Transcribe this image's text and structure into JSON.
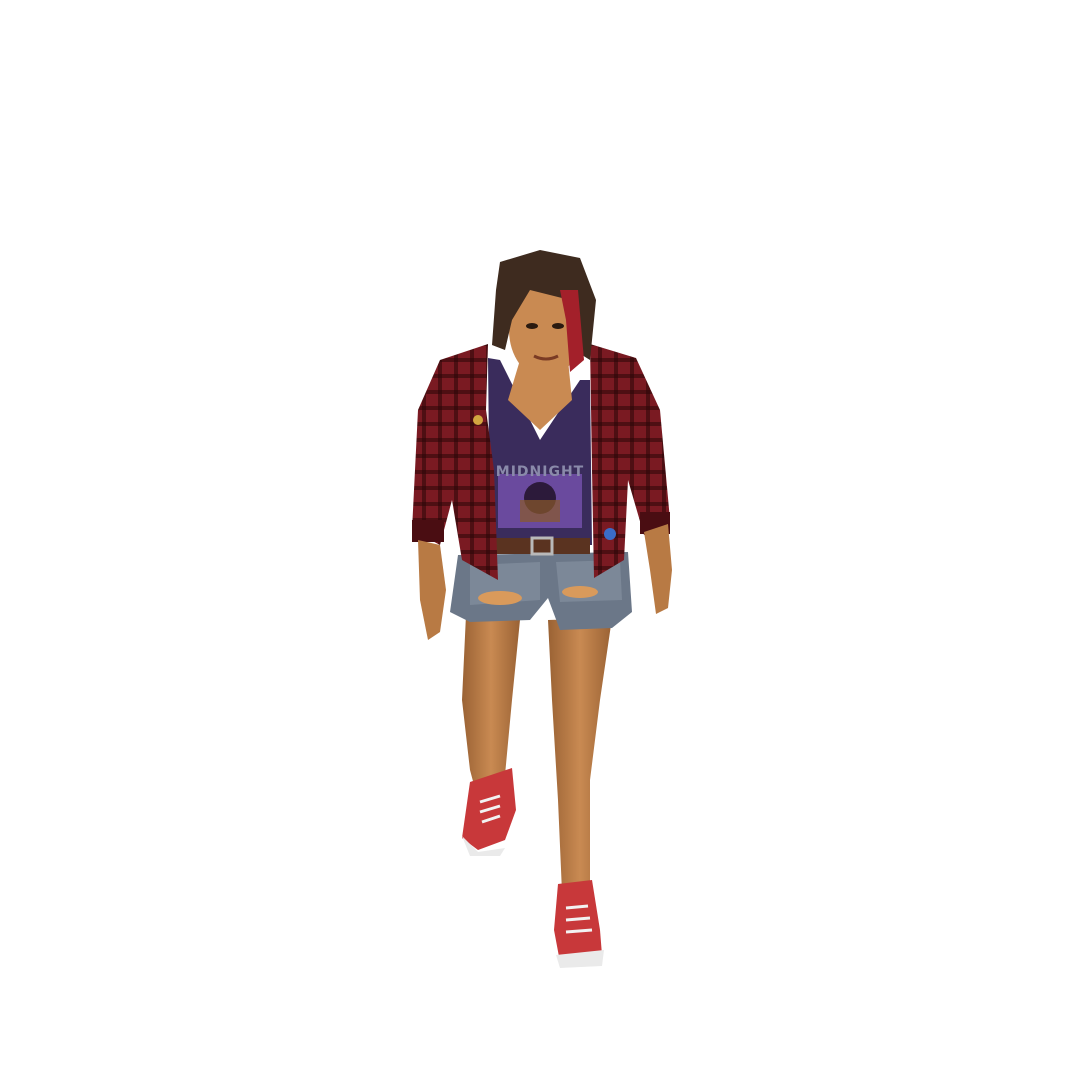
{
  "scene": {
    "background_color": "#ffffff"
  },
  "character": {
    "colors": {
      "skin": "#c98a52",
      "skin_shadow": "#9a6234",
      "hair": "#3e2b1f",
      "hair_streak": "#a3202a",
      "jacket": "#7a1a22",
      "jacket_dark": "#4a0d12",
      "jacket_check": "#2a0608",
      "tank_top": "#3a2c5c",
      "shirt_print": "#6a4a9e",
      "belt": "#5a3320",
      "buckle": "#b9b9b9",
      "shorts": "#6b7788",
      "shorts_light": "#8d99a8",
      "shorts_rip": "#d99a5b",
      "shoe": "#c8383a",
      "shoe_sole": "#eaeaea",
      "laces": "#f2f2f2"
    },
    "shirt_print_text": "MIDNIGHT"
  }
}
